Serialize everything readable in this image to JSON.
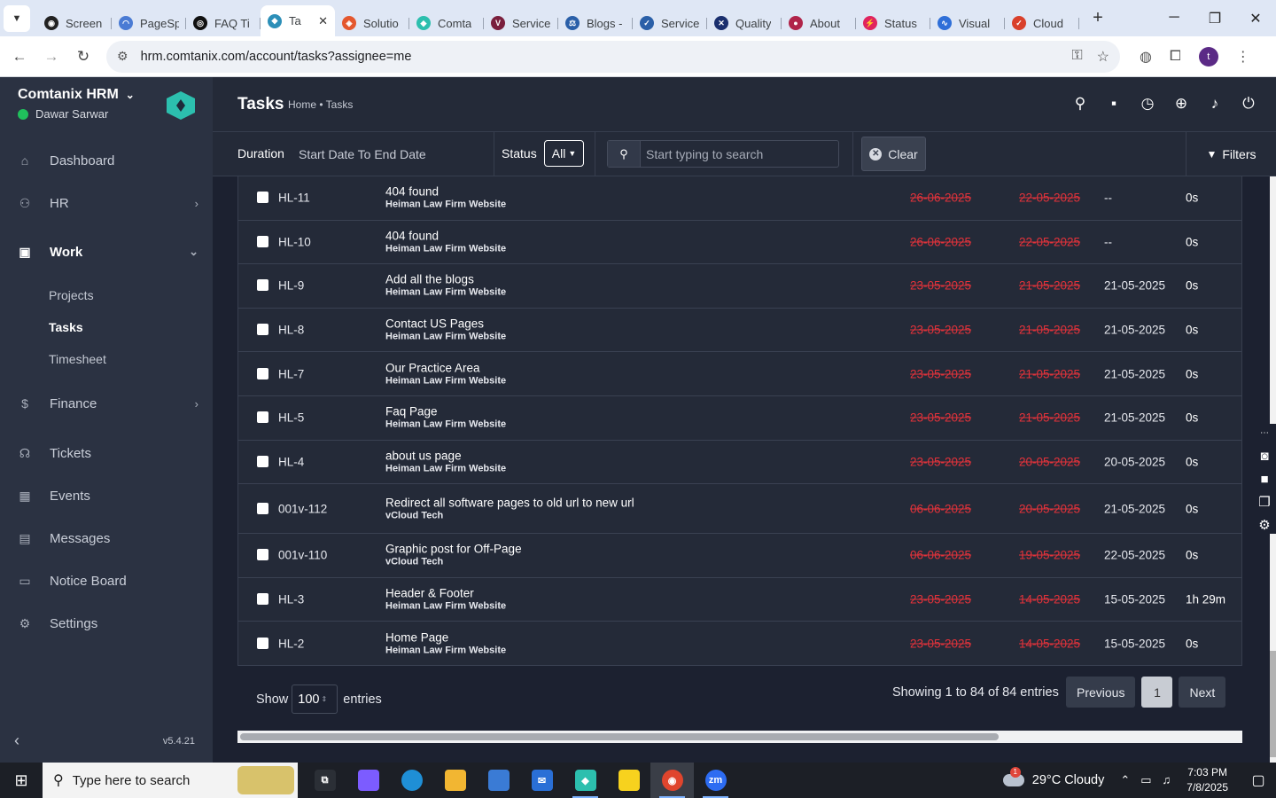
{
  "browser": {
    "tabs": [
      {
        "label": "Screen",
        "color": "#222222",
        "glyph": "◉"
      },
      {
        "label": "PageSp",
        "color": "#4a7bd4",
        "glyph": "◠"
      },
      {
        "label": "FAQ Ti",
        "color": "#111111",
        "glyph": "◎"
      },
      {
        "label": "Ta",
        "color": "#2c8fb8",
        "glyph": "◆",
        "active": true
      },
      {
        "label": "Solutio",
        "color": "#e4572e",
        "glyph": "◈"
      },
      {
        "label": "Comta",
        "color": "#2cbfae",
        "glyph": "◆"
      },
      {
        "label": "Service",
        "color": "#7a1f3d",
        "glyph": "V"
      },
      {
        "label": "Blogs -",
        "color": "#2a5fa8",
        "glyph": "⚖"
      },
      {
        "label": "Service",
        "color": "#2a5fa8",
        "glyph": "✓"
      },
      {
        "label": "Quality",
        "color": "#1a2f6e",
        "glyph": "✕"
      },
      {
        "label": "About",
        "color": "#b0244a",
        "glyph": "●"
      },
      {
        "label": "Status",
        "color": "#e0245e",
        "glyph": "⚡"
      },
      {
        "label": "Visual",
        "color": "#2f6fd8",
        "glyph": "∿"
      },
      {
        "label": "Cloud",
        "color": "#d9402b",
        "glyph": "✓"
      }
    ],
    "url": "hrm.comtanix.com/account/tasks?assignee=me",
    "profile_initial": "t"
  },
  "sidebar": {
    "brand": "Comtanix HRM",
    "user": "Dawar Sarwar",
    "menu": {
      "dashboard": "Dashboard",
      "hr": "HR",
      "work": "Work",
      "projects": "Projects",
      "tasks": "Tasks",
      "timesheet": "Timesheet",
      "finance": "Finance",
      "tickets": "Tickets",
      "events": "Events",
      "messages": "Messages",
      "notice_board": "Notice Board",
      "settings": "Settings"
    },
    "version": "v5.4.21"
  },
  "header": {
    "title": "Tasks",
    "breadcrumb": "Home • Tasks"
  },
  "filters": {
    "duration_label": "Duration",
    "duration_value": "Start Date To End Date",
    "status_label": "Status",
    "status_value": "All",
    "search_placeholder": "Start typing to search",
    "clear_label": "Clear",
    "filters_label": "Filters"
  },
  "tasks": [
    {
      "id": "HL-11",
      "name": "404 found",
      "project": "Heiman Law Firm Website",
      "due": "26-06-2025",
      "start": "22-05-2025",
      "completed": "--",
      "hours": "0s"
    },
    {
      "id": "HL-10",
      "name": "404 found",
      "project": "Heiman Law Firm Website",
      "due": "26-06-2025",
      "start": "22-05-2025",
      "completed": "--",
      "hours": "0s"
    },
    {
      "id": "HL-9",
      "name": "Add all the blogs",
      "project": "Heiman Law Firm Website",
      "due": "23-05-2025",
      "start": "21-05-2025",
      "completed": "21-05-2025",
      "hours": "0s"
    },
    {
      "id": "HL-8",
      "name": "Contact US Pages",
      "project": "Heiman Law Firm Website",
      "due": "23-05-2025",
      "start": "21-05-2025",
      "completed": "21-05-2025",
      "hours": "0s"
    },
    {
      "id": "HL-7",
      "name": "Our Practice Area",
      "project": "Heiman Law Firm Website",
      "due": "23-05-2025",
      "start": "21-05-2025",
      "completed": "21-05-2025",
      "hours": "0s"
    },
    {
      "id": "HL-5",
      "name": "Faq Page",
      "project": "Heiman Law Firm Website",
      "due": "23-05-2025",
      "start": "21-05-2025",
      "completed": "21-05-2025",
      "hours": "0s"
    },
    {
      "id": "HL-4",
      "name": "about us page",
      "project": "Heiman Law Firm Website",
      "due": "23-05-2025",
      "start": "20-05-2025",
      "completed": "20-05-2025",
      "hours": "0s"
    },
    {
      "id": "001v-112",
      "name": "Redirect all software pages to old url to new url",
      "project": "vCloud Tech",
      "due": "06-06-2025",
      "start": "20-05-2025",
      "completed": "21-05-2025",
      "hours": "0s",
      "tall": true
    },
    {
      "id": "001v-110",
      "name": "Graphic post for Off-Page",
      "project": "vCloud Tech",
      "due": "06-06-2025",
      "start": "19-05-2025",
      "completed": "22-05-2025",
      "hours": "0s"
    },
    {
      "id": "HL-3",
      "name": "Header & Footer",
      "project": "Heiman Law Firm Website",
      "due": "23-05-2025",
      "start": "14-05-2025",
      "completed": "15-05-2025",
      "hours": "1h 29m"
    },
    {
      "id": "HL-2",
      "name": "Home Page",
      "project": "Heiman Law Firm Website",
      "due": "23-05-2025",
      "start": "14-05-2025",
      "completed": "15-05-2025",
      "hours": "0s"
    }
  ],
  "pagination": {
    "show_label": "Show",
    "page_size": "100",
    "entries_label": "entries",
    "summary": "Showing 1 to 84 of 84 entries",
    "previous": "Previous",
    "current_page": "1",
    "next": "Next"
  },
  "taskbar": {
    "search_placeholder": "Type here to search",
    "apps": [
      {
        "name": "task-view",
        "color": "#2b2f36",
        "glyph": "⧉"
      },
      {
        "name": "copilot",
        "color": "#7c5cff",
        "glyph": ""
      },
      {
        "name": "edge",
        "color": "#1f8fd6",
        "glyph": ""
      },
      {
        "name": "file-explorer",
        "color": "#f2b632",
        "glyph": ""
      },
      {
        "name": "microsoft-store",
        "color": "#3a7bd5",
        "glyph": ""
      },
      {
        "name": "mail",
        "color": "#2a6fd6",
        "glyph": "✉"
      },
      {
        "name": "comtanix",
        "color": "#2cbfae",
        "glyph": "◆"
      },
      {
        "name": "sticky-notes",
        "color": "#f7d21e",
        "glyph": ""
      },
      {
        "name": "chrome",
        "color": "#e0452d",
        "glyph": "◉"
      },
      {
        "name": "zoom",
        "color": "#2d6cf2",
        "glyph": "zm"
      }
    ],
    "weather": "29°C  Cloudy",
    "weather_badge": "1",
    "time": "7:03 PM",
    "date": "7/8/2025"
  },
  "colors": {
    "sidebar_bg": "#2b3242",
    "content_bg": "#242a38",
    "overdue_red": "#e2323a",
    "online_green": "#20c05c",
    "brand_teal": "#2cbfae"
  }
}
